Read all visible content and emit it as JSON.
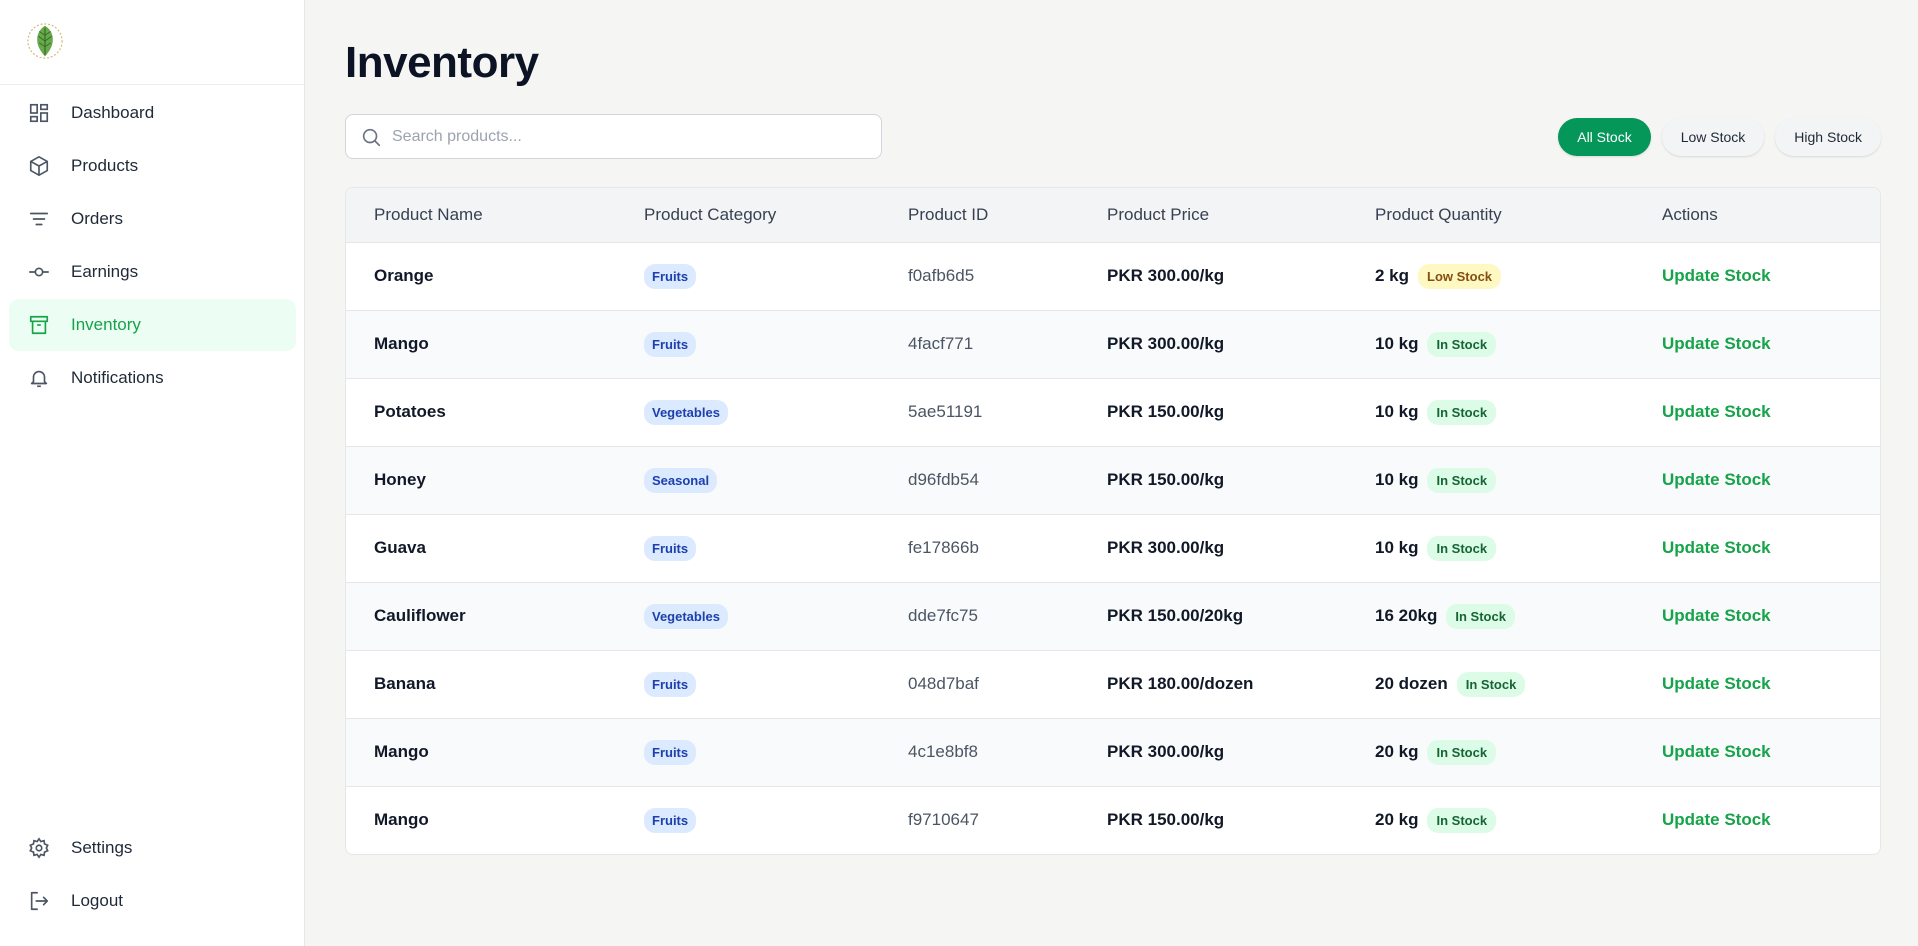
{
  "sidebar": {
    "items": [
      {
        "label": "Dashboard",
        "icon": "dashboard-icon"
      },
      {
        "label": "Products",
        "icon": "box-icon"
      },
      {
        "label": "Orders",
        "icon": "filter-lines-icon"
      },
      {
        "label": "Earnings",
        "icon": "earnings-icon"
      },
      {
        "label": "Inventory",
        "icon": "archive-icon",
        "active": true
      },
      {
        "label": "Notifications",
        "icon": "bell-icon"
      }
    ],
    "bottom": [
      {
        "label": "Settings",
        "icon": "gear-icon"
      },
      {
        "label": "Logout",
        "icon": "logout-icon"
      }
    ]
  },
  "page": {
    "title": "Inventory"
  },
  "search": {
    "placeholder": "Search products...",
    "value": ""
  },
  "filters": [
    {
      "label": "All Stock",
      "active": true
    },
    {
      "label": "Low Stock",
      "active": false
    },
    {
      "label": "High Stock",
      "active": false
    }
  ],
  "table": {
    "headers": [
      "Product Name",
      "Product Category",
      "Product ID",
      "Product Price",
      "Product Quantity",
      "Actions"
    ],
    "action_label": "Update Stock",
    "rows": [
      {
        "name": "Orange",
        "category": "Fruits",
        "id": "f0afb6d5",
        "price": "PKR 300.00/kg",
        "quantity": "2 kg",
        "status": "Low Stock"
      },
      {
        "name": "Mango",
        "category": "Fruits",
        "id": "4facf771",
        "price": "PKR 300.00/kg",
        "quantity": "10 kg",
        "status": "In Stock"
      },
      {
        "name": "Potatoes",
        "category": "Vegetables",
        "id": "5ae51191",
        "price": "PKR 150.00/kg",
        "quantity": "10 kg",
        "status": "In Stock"
      },
      {
        "name": "Honey",
        "category": "Seasonal",
        "id": "d96fdb54",
        "price": "PKR 150.00/kg",
        "quantity": "10 kg",
        "status": "In Stock"
      },
      {
        "name": "Guava",
        "category": "Fruits",
        "id": "fe17866b",
        "price": "PKR 300.00/kg",
        "quantity": "10 kg",
        "status": "In Stock"
      },
      {
        "name": "Cauliflower",
        "category": "Vegetables",
        "id": "dde7fc75",
        "price": "PKR 150.00/20kg",
        "quantity": "16 20kg",
        "status": "In Stock"
      },
      {
        "name": "Banana",
        "category": "Fruits",
        "id": "048d7baf",
        "price": "PKR 180.00/dozen",
        "quantity": "20 dozen",
        "status": "In Stock"
      },
      {
        "name": "Mango",
        "category": "Fruits",
        "id": "4c1e8bf8",
        "price": "PKR 300.00/kg",
        "quantity": "20 kg",
        "status": "In Stock"
      },
      {
        "name": "Mango",
        "category": "Fruits",
        "id": "f9710647",
        "price": "PKR 150.00/kg",
        "quantity": "20 kg",
        "status": "In Stock"
      }
    ]
  },
  "colors": {
    "accent": "#05965a",
    "active_nav_bg": "#ecfdf3",
    "low_badge": "#fef9c3",
    "in_badge": "#dcfce7",
    "category_badge": "#dbeafe"
  }
}
